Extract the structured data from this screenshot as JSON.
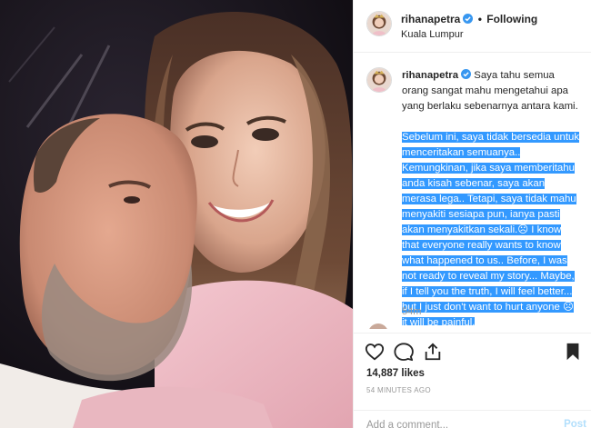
{
  "header": {
    "username": "rihanapetra",
    "separator": "•",
    "follow_status": "Following",
    "location": "Kuala Lumpur"
  },
  "caption": {
    "username": "rihanapetra",
    "intro": "Saya tahu semua orang sangat mahu mengetahui apa yang berlaku sebenarnya antara kami.",
    "selected_text": "Sebelum ini, saya tidak bersedia untuk menceritakan semuanya.. Kemungkinan, jika saya memberitahu anda kisah sebenar, saya akan merasa lega.. Tetapi, saya tidak mahu menyakiti sesiapa pun, ianya pasti akan menyakitkan sekali.☹︎ I know that everyone really wants to know what happened to us.. Before, I was not ready to reveal my story... Maybe, if I tell you the truth, I will feel better... but I just don't want to hurt anyone ☹︎ it will be painful.",
    "time_ago": "54m"
  },
  "actions": {
    "likes": "14,887 likes",
    "timestamp": "54 MINUTES AGO",
    "comment_placeholder": "Add a comment...",
    "post_label": "Post"
  },
  "icons": {
    "like": "heart-icon",
    "comment": "comment-icon",
    "share": "share-icon",
    "save": "bookmark-icon",
    "verified": "verified-badge-icon"
  },
  "colors": {
    "verified": "#3897f0",
    "selection": "#3399ff",
    "post_button": "#b2dffc",
    "muted_text": "#999999"
  }
}
